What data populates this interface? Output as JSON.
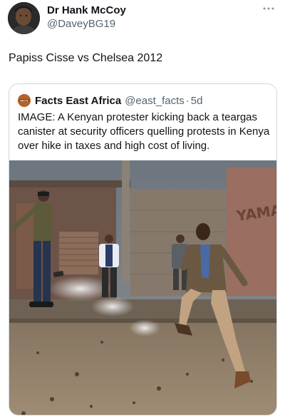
{
  "tweet": {
    "author": {
      "name": "Dr Hank McCoy",
      "handle": "@DaveyBG19"
    },
    "text": "Papiss Cisse vs Chelsea 2012",
    "more_icon": "more-horizontal-icon"
  },
  "quote": {
    "author": {
      "name": "Facts East Africa",
      "handle": "@east_facts",
      "separator": "·",
      "time": "5d"
    },
    "avatar_text": "FACTS",
    "text": "IMAGE: A Kenyan protester kicking back a teargas canister at security officers quelling protests in Kenya over hike in taxes and high cost of living.",
    "media_alt": "Photo of a man mid-kick on a dusty street with a smoking teargas canister, other people and buildings behind him",
    "wall_text": "YAMA"
  },
  "colors": {
    "text_primary": "#0f1419",
    "text_secondary": "#536471",
    "border": "#cfd9de",
    "quote_avatar": "#b5632a"
  }
}
